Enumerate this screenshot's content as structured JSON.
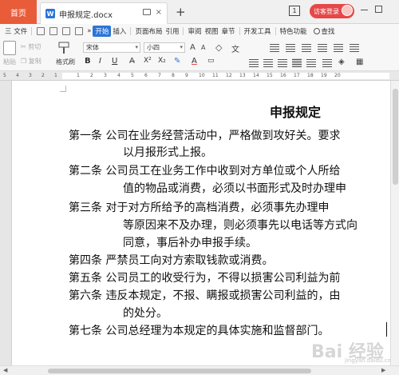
{
  "titlebar": {
    "home_tab": "首页",
    "doc_tab": "申报规定.docx",
    "doc_icon": "W",
    "new_tab": "+",
    "page_indicator": "1",
    "login": "访客登录"
  },
  "menu": {
    "file": "三 文件",
    "overflow": "»",
    "items": [
      "开始",
      "插入",
      "页面布局",
      "引用",
      "审阅",
      "视图",
      "章节",
      "开发工具",
      "特色功能"
    ],
    "search": "查找"
  },
  "toolbar": {
    "paste": "粘贴",
    "cut": "剪切",
    "copy": "复制",
    "format_painter": "格式刷",
    "font_name": "宋体",
    "font_size": "小四",
    "bold": "B",
    "italic": "I",
    "underline": "U",
    "font_color_a": "A",
    "grow": "A",
    "shrink": "A",
    "clear": "◇",
    "wen": "文"
  },
  "ruler": {
    "labels": [
      "5",
      "4",
      "3",
      "2",
      "1",
      "1",
      "2",
      "3",
      "4",
      "5",
      "6",
      "7",
      "8",
      "9",
      "10",
      "11",
      "12",
      "13",
      "14",
      "15",
      "16",
      "17",
      "18",
      "19",
      "20"
    ]
  },
  "document": {
    "title": "申报规定",
    "lines": [
      "第一条  公司在业务经营活动中，严格做到攻好关。要求",
      "以月报形式上报。",
      "第二条  公司员工在业务工作中收到对方单位或个人所给",
      "值的物品或消费，必须以书面形式及时办理申",
      "第三条  对于对方所给予的高档消费，必须事先办理申",
      "等原因来不及办理，则必须事先以电话等方式向",
      "同意，事后补办申报手续。",
      "第四条  严禁员工向对方索取钱款或消费。",
      "第五条  公司员工的收受行为，不得以损害公司利益为前",
      "第六条  违反本规定，不报、瞒报或损害公司利益的，由",
      "的处分。",
      "第七条  公司总经理为本规定的具体实施和监督部门。"
    ]
  },
  "watermark": {
    "text": "Bai 经验",
    "sub": "jingyan.baidu.com"
  }
}
